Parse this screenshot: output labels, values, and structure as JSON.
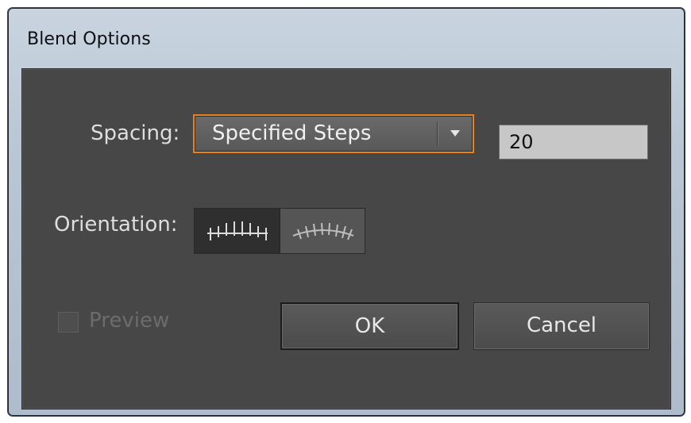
{
  "window": {
    "title": "Blend Options"
  },
  "spacing": {
    "label": "Spacing:",
    "selected": "Specified Steps",
    "steps_value": "20"
  },
  "orientation": {
    "label": "Orientation:",
    "options": [
      "align-to-page-icon",
      "align-to-path-icon"
    ],
    "selected_index": 0
  },
  "preview": {
    "label": "Preview",
    "checked": false,
    "enabled": false
  },
  "buttons": {
    "ok": "OK",
    "cancel": "Cancel"
  },
  "colors": {
    "focus_accent": "#e8821f",
    "client_bg": "#474747"
  }
}
